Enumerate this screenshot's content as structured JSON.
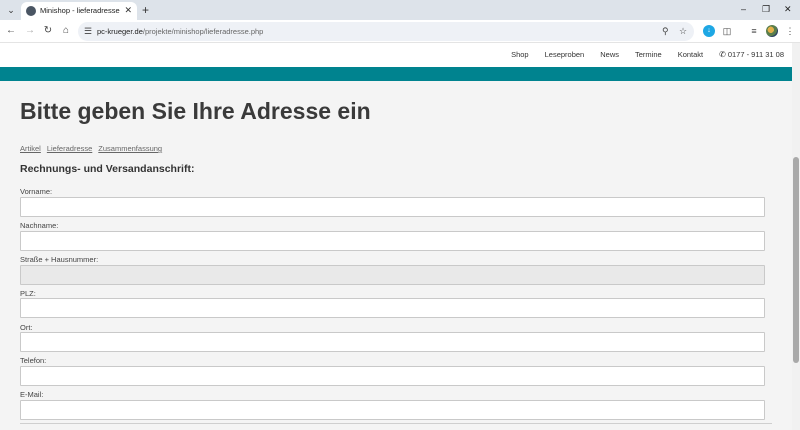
{
  "browser": {
    "tab_title": "Minishop - lieferadresse",
    "url_host": "pc-krueger.de",
    "url_path": "/projekte/minishop/lieferadresse.php"
  },
  "header": {
    "nav": [
      "Shop",
      "Leseproben",
      "News",
      "Termine",
      "Kontakt"
    ],
    "phone": "0177 - 911 31 08"
  },
  "colors": {
    "brand": "#00838f"
  },
  "page": {
    "title": "Bitte geben Sie Ihre Adresse ein",
    "breadcrumb": [
      "Artikel",
      "Lieferadresse",
      "Zusammenfassung"
    ],
    "section_title": "Rechnungs- und Versandanschrift:"
  },
  "form": {
    "fields": [
      {
        "label": "Vorname:",
        "value": ""
      },
      {
        "label": "Nachname:",
        "value": ""
      },
      {
        "label": "Straße + Hausnummer:",
        "value": ""
      },
      {
        "label": "PLZ:",
        "value": ""
      },
      {
        "label": "Ort:",
        "value": ""
      },
      {
        "label": "Telefon:",
        "value": ""
      },
      {
        "label": "E-Mail:",
        "value": ""
      }
    ]
  }
}
